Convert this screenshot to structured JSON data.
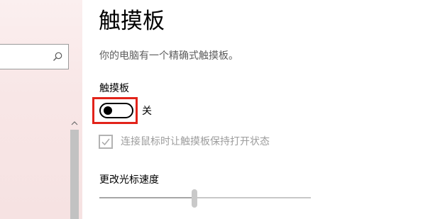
{
  "page": {
    "title": "触摸板",
    "description": "你的电脑有一个精确式触摸板。"
  },
  "nav": {
    "search": {
      "value": "",
      "placeholder": "",
      "icon": "search-icon"
    },
    "scrollbar": {
      "up_glyph": "⌃"
    }
  },
  "touchpad_toggle": {
    "label": "触摸板",
    "state_text": "关",
    "on": false,
    "highlight_color": "#e2231a"
  },
  "keep_on_with_mouse": {
    "label": "连接鼠标时让触摸板保持打开状态",
    "checked": true,
    "disabled": true
  },
  "cursor_speed": {
    "label": "更改光标速度",
    "level": 0.45
  }
}
